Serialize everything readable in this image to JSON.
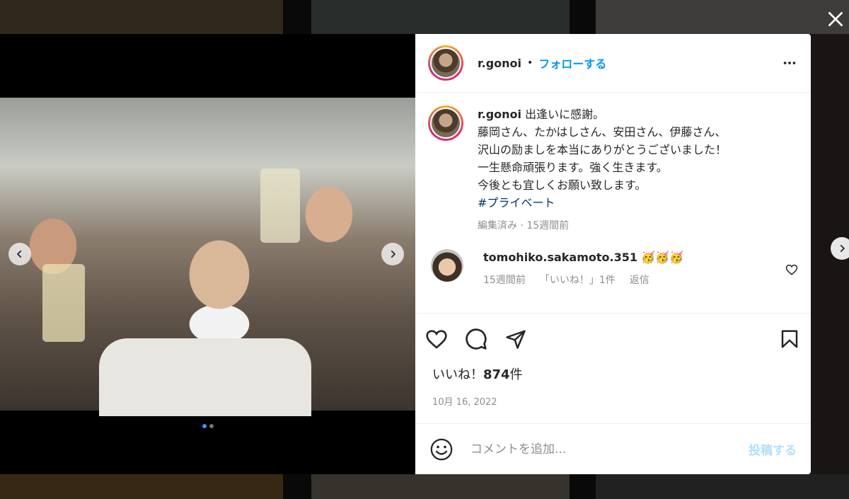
{
  "post": {
    "username": "r.gonoi",
    "separator": "•",
    "follow_label": "フォローする",
    "caption_lines": [
      "出逢いに感謝。",
      "藤岡さん、たかはしさん、安田さん、伊藤さん、",
      "沢山の励ましを本当にありがとうございました！",
      "一生懸命頑張ります。強く生きます。",
      "今後とも宜しくお願い致します。"
    ],
    "hashtag": "#プライベート",
    "caption_meta": "編集済み · 15週間前",
    "comment": {
      "username": "tomohiko.sakamoto.351",
      "text": "🥳🥳🥳",
      "time": "15週間前",
      "likes": "「いいね！」1件",
      "reply_label": "返信"
    },
    "likes_prefix": "いいね！",
    "likes_count": "874",
    "likes_suffix": "件",
    "date": "10月 16, 2022",
    "comment_placeholder": "コメントを追加...",
    "post_label": "投稿する",
    "carousel": {
      "current": 1,
      "total": 2
    }
  },
  "colors": {
    "accent": "#0095f6",
    "post_disabled": "#b2dffc",
    "meta": "#8e8e8e"
  },
  "icons": [
    "close-icon",
    "more-icon",
    "chevron-left-icon",
    "chevron-right-icon",
    "heart-icon",
    "comment-icon",
    "share-icon",
    "bookmark-icon",
    "emoji-icon"
  ]
}
